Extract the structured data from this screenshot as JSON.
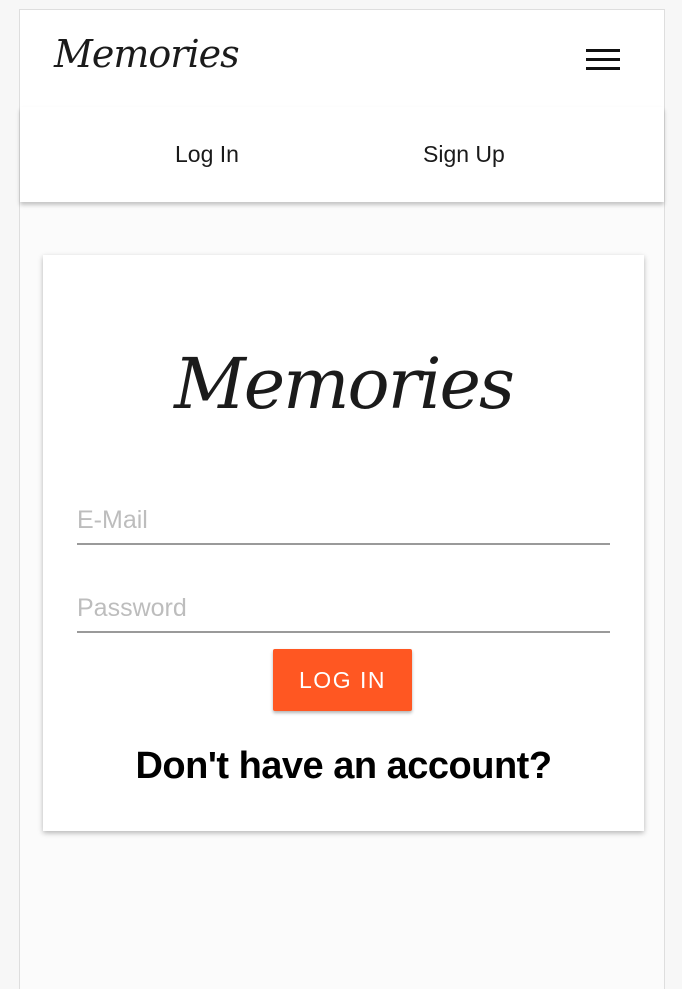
{
  "header": {
    "brand": "Memories",
    "menu_icon": "hamburger-menu-icon"
  },
  "tabs": [
    {
      "label": "Log In"
    },
    {
      "label": "Sign Up"
    }
  ],
  "login_card": {
    "logo": "Memories",
    "email": {
      "placeholder": "E-Mail",
      "value": ""
    },
    "password": {
      "placeholder": "Password",
      "value": ""
    },
    "submit_label": "LOG IN",
    "signup_prompt": "Don't have an account?"
  },
  "colors": {
    "accent": "#ff5722",
    "text": "#1b1b1b",
    "background": "#f7f7f7"
  }
}
